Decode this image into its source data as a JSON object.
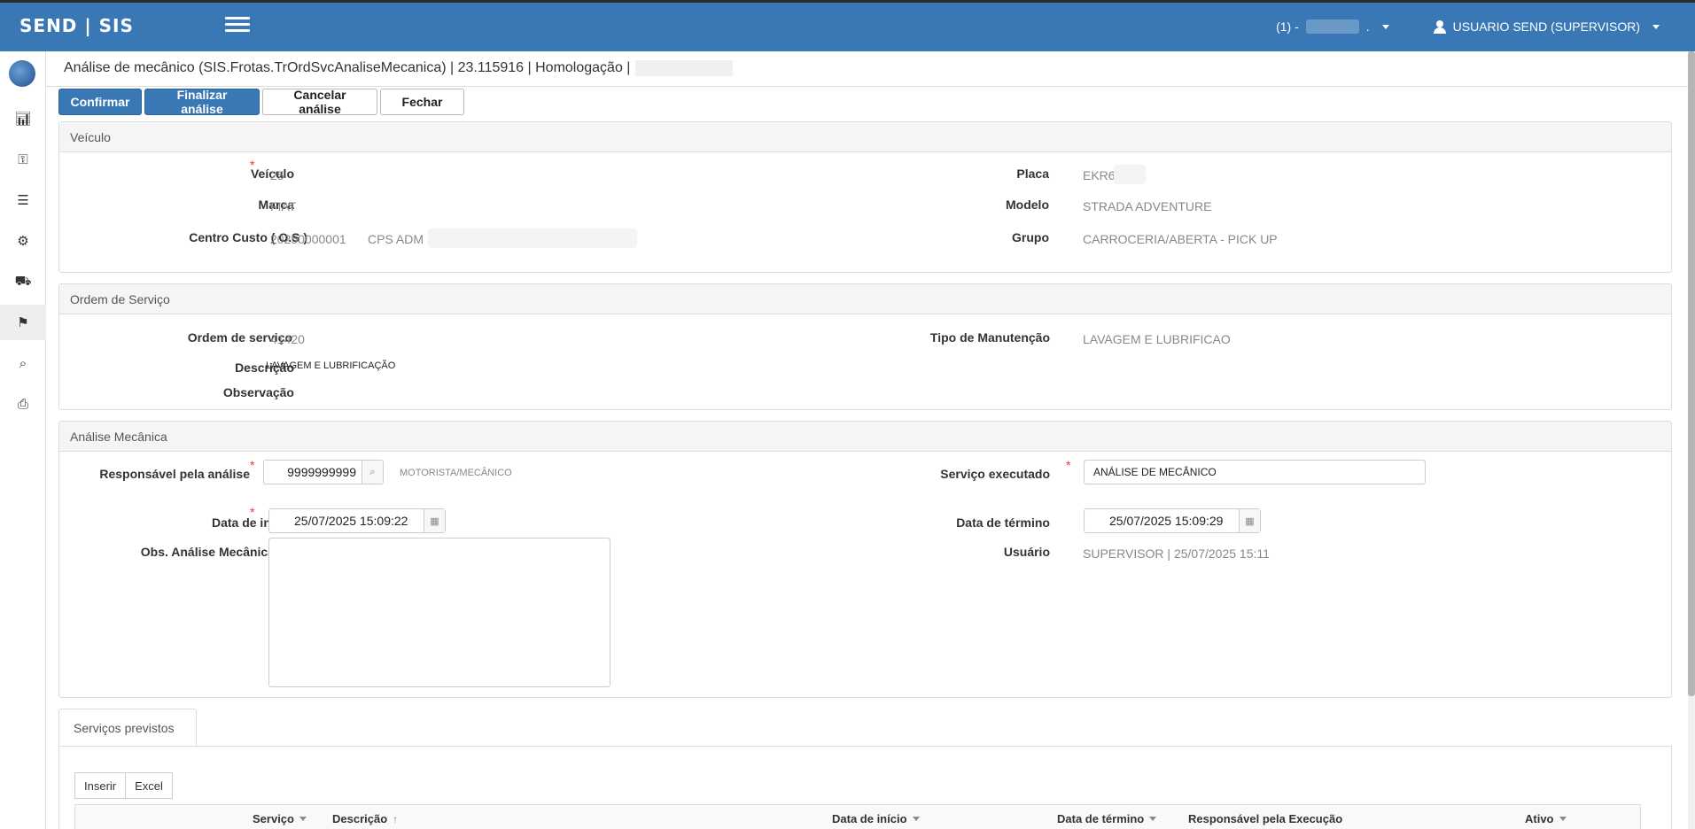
{
  "app": {
    "brand": "SEND | SIS"
  },
  "topbar": {
    "org_prefix": "(1) -",
    "org_suffix": ".",
    "user_label": "USUARIO SEND (SUPERVISOR)"
  },
  "page": {
    "title": "Análise de mecânico (SIS.Frotas.TrOrdSvcAnaliseMecanica) | 23.115916 | Homologação |"
  },
  "toolbar": {
    "confirm": "Confirmar",
    "finish": "Finalizar análise",
    "cancel": "Cancelar análise",
    "close": "Fechar"
  },
  "vehicle": {
    "header": "Veículo",
    "veiculo_label": "Veículo",
    "veiculo_value": "25",
    "marca_label": "Marca",
    "marca_value": "FIAT",
    "centro_label": "Centro Custo ( O.S )",
    "centro_code": "20250000001",
    "centro_name": "CPS ADM",
    "placa_label": "Placa",
    "placa_value": "EKR6",
    "modelo_label": "Modelo",
    "modelo_value": "STRADA ADVENTURE",
    "grupo_label": "Grupo",
    "grupo_value": "CARROCERIA/ABERTA - PICK UP"
  },
  "service_order": {
    "header": "Ordem de Serviço",
    "ordem_label": "Ordem de serviço",
    "ordem_value": "41420",
    "descricao_label": "Descrição",
    "descricao_value": "LAVAGEM E LUBRIFICAÇÃO",
    "obs_label": "Observação",
    "tipo_label": "Tipo de Manutenção",
    "tipo_value": "LAVAGEM E LUBRIFICAO"
  },
  "analysis": {
    "header": "Análise Mecânica",
    "responsavel_label": "Responsável pela análise",
    "responsavel_value": "9999999999",
    "responsavel_desc": "MOTORISTA/MECÂNICO",
    "servico_label": "Serviço executado",
    "servico_value": "ANÁLISE DE MECÂNICO",
    "inicio_label": "Data de início",
    "inicio_value": "25/07/2025 15:09:22",
    "termino_label": "Data de término",
    "termino_value": "25/07/2025 15:09:29",
    "obs_label": "Obs. Análise Mecânica",
    "usuario_label": "Usuário",
    "usuario_value": "SUPERVISOR | 25/07/2025 15:11"
  },
  "tabs": {
    "servicos_previstos": "Serviços previstos"
  },
  "grid": {
    "insert": "Inserir",
    "excel": "Excel",
    "columns": [
      "Serviço",
      "Descrição",
      "Data de início",
      "Data de término",
      "Responsável pela Execução",
      "Ativo"
    ]
  },
  "colors": {
    "primary": "#3a77b5",
    "required": "#e33333"
  }
}
